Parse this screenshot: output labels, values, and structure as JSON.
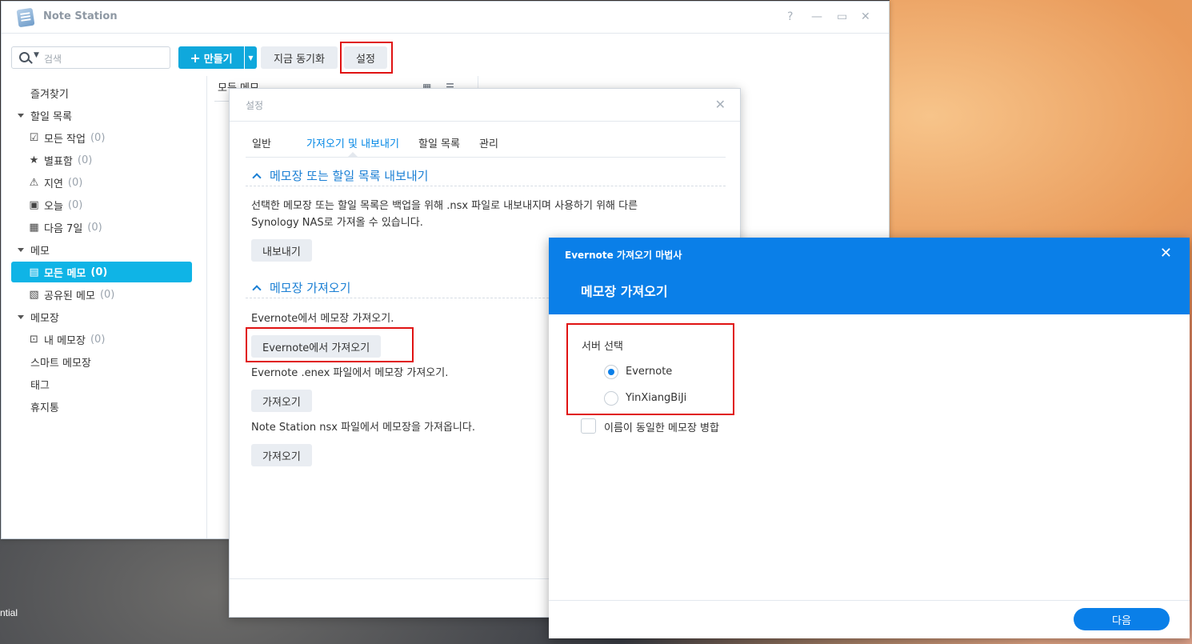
{
  "desktop": {
    "label": "ntial"
  },
  "main_window": {
    "title": "Note Station",
    "controls": {
      "help": "?",
      "minimize": "—",
      "maximize": "▭",
      "close": "✕"
    },
    "toolbar": {
      "search_placeholder": "검색",
      "create_label": "만들기",
      "sync_label": "지금 동기화",
      "settings_label": "설정"
    },
    "list_header": "모든 메모",
    "sidebar": {
      "favorites": "즐겨찾기",
      "todo_head": "할일 목록",
      "todo_items": [
        {
          "label": "모든 작업",
          "count": "(0)"
        },
        {
          "label": "별표함",
          "count": "(0)"
        },
        {
          "label": "지연",
          "count": "(0)"
        },
        {
          "label": "오늘",
          "count": "(0)"
        },
        {
          "label": "다음 7일",
          "count": "(0)"
        }
      ],
      "memo_head": "메모",
      "memo_items": [
        {
          "label": "모든 메모",
          "count": "(0)"
        },
        {
          "label": "공유된 메모",
          "count": "(0)"
        }
      ],
      "notebook_head": "메모장",
      "notebook_items": [
        {
          "label": "내 메모장",
          "count": "(0)"
        }
      ],
      "smart_notebook": "스마트 메모장",
      "tags": "태그",
      "trash": "휴지통"
    }
  },
  "settings": {
    "title": "설정",
    "tabs": [
      "일반",
      "가져오기 및 내보내기",
      "할일 목록",
      "관리"
    ],
    "active_tab": "가져오기 및 내보내기",
    "export_section": {
      "title": "메모장 또는 할일 목록 내보내기",
      "description_line1": "선택한 메모장 또는 할일 목록은 백업을 위해 .nsx 파일로 내보내지며 사용하기 위해 다른",
      "description_line2": "Synology NAS로 가져올 수 있습니다.",
      "button": "내보내기"
    },
    "import_section": {
      "title": "메모장 가져오기",
      "evernote_desc": "Evernote에서 메모장 가져오기.",
      "evernote_button": "Evernote에서 가져오기",
      "enex_desc": "Evernote .enex 파일에서 메모장 가져오기.",
      "enex_button": "가져오기",
      "nsx_desc": "Note Station nsx 파일에서 메모장을 가져옵니다.",
      "nsx_button": "가져오기"
    }
  },
  "wizard": {
    "title": "Evernote 가져오기 마법사",
    "step_title": "메모장 가져오기",
    "server_label": "서버 선택",
    "options": [
      "Evernote",
      "YinXiangBiJi"
    ],
    "selected_option": "Evernote",
    "merge_label": "이름이 동일한 메모장 병합",
    "merge_checked": false,
    "next_button": "다음"
  },
  "colors": {
    "accent": "#0a7fe8",
    "create_button": "#0fa8dc",
    "sidebar_selected": "#0fb4e6",
    "highlight_box": "#e01212",
    "section_title": "#1a7fd4"
  }
}
